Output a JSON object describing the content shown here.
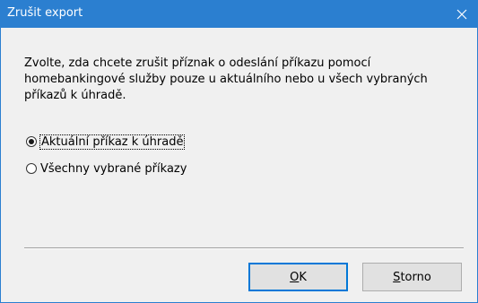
{
  "window": {
    "title": "Zrušit export",
    "close_icon": "close-icon",
    "titlebar_color": "#2b7fd0"
  },
  "message": "Zvolte, zda chcete zrušit příznak o odeslání příkazu pomocí homebankingové služby pouze u aktuálního nebo u všech vybraných příkazů k úhradě.",
  "options": [
    {
      "label": "Aktuální příkaz k úhradě",
      "selected": true
    },
    {
      "label": "Všechny vybrané příkazy",
      "selected": false
    }
  ],
  "buttons": {
    "ok": {
      "mnemonic": "O",
      "rest": "K"
    },
    "cancel": {
      "mnemonic": "S",
      "rest": "torno"
    }
  }
}
